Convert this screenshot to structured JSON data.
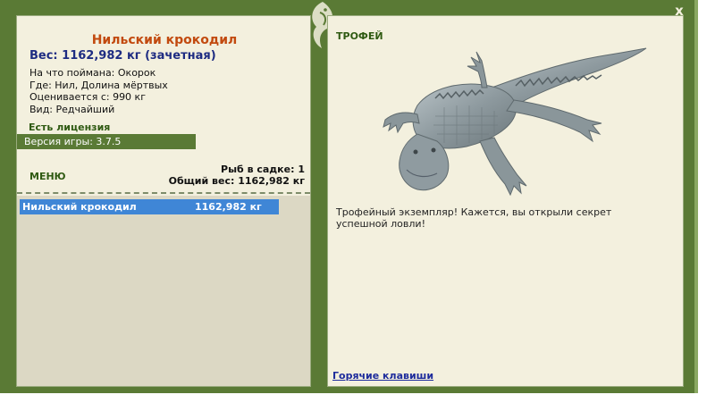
{
  "window": {
    "close_label": "x"
  },
  "fish": {
    "title": "Нильский крокодил",
    "weight_line": "Вес: 1162,982 кг (зачетная)",
    "caught_on": "На что поймана: Окорок",
    "location": "Где: Нил, Долина мёртвых",
    "valued_from": "Оценивается с: 990 кг",
    "kind": "Вид: Редчайший"
  },
  "license": "Есть лицензия",
  "version": "Версия игры: 3.7.5",
  "menu_label": "МЕНЮ",
  "stats": {
    "fish_in_cage": "Рыб в садке: 1",
    "total_weight": "Общий вес: 1162,982 кг"
  },
  "catch_list": [
    {
      "name": "Нильский крокодил",
      "weight": "1162,982 кг"
    }
  ],
  "trophy": {
    "label": "ТРОФЕЙ",
    "message": "Трофейный экземпляр! Кажется, вы открыли секрет успешной ловли!"
  },
  "hotkeys_label": "Горячие клавиши",
  "colors": {
    "frame": "#5a7a35",
    "panel": "#f3f0de",
    "title": "#c24a0f",
    "weight": "#1e2c82",
    "selection": "#3f86d6"
  }
}
